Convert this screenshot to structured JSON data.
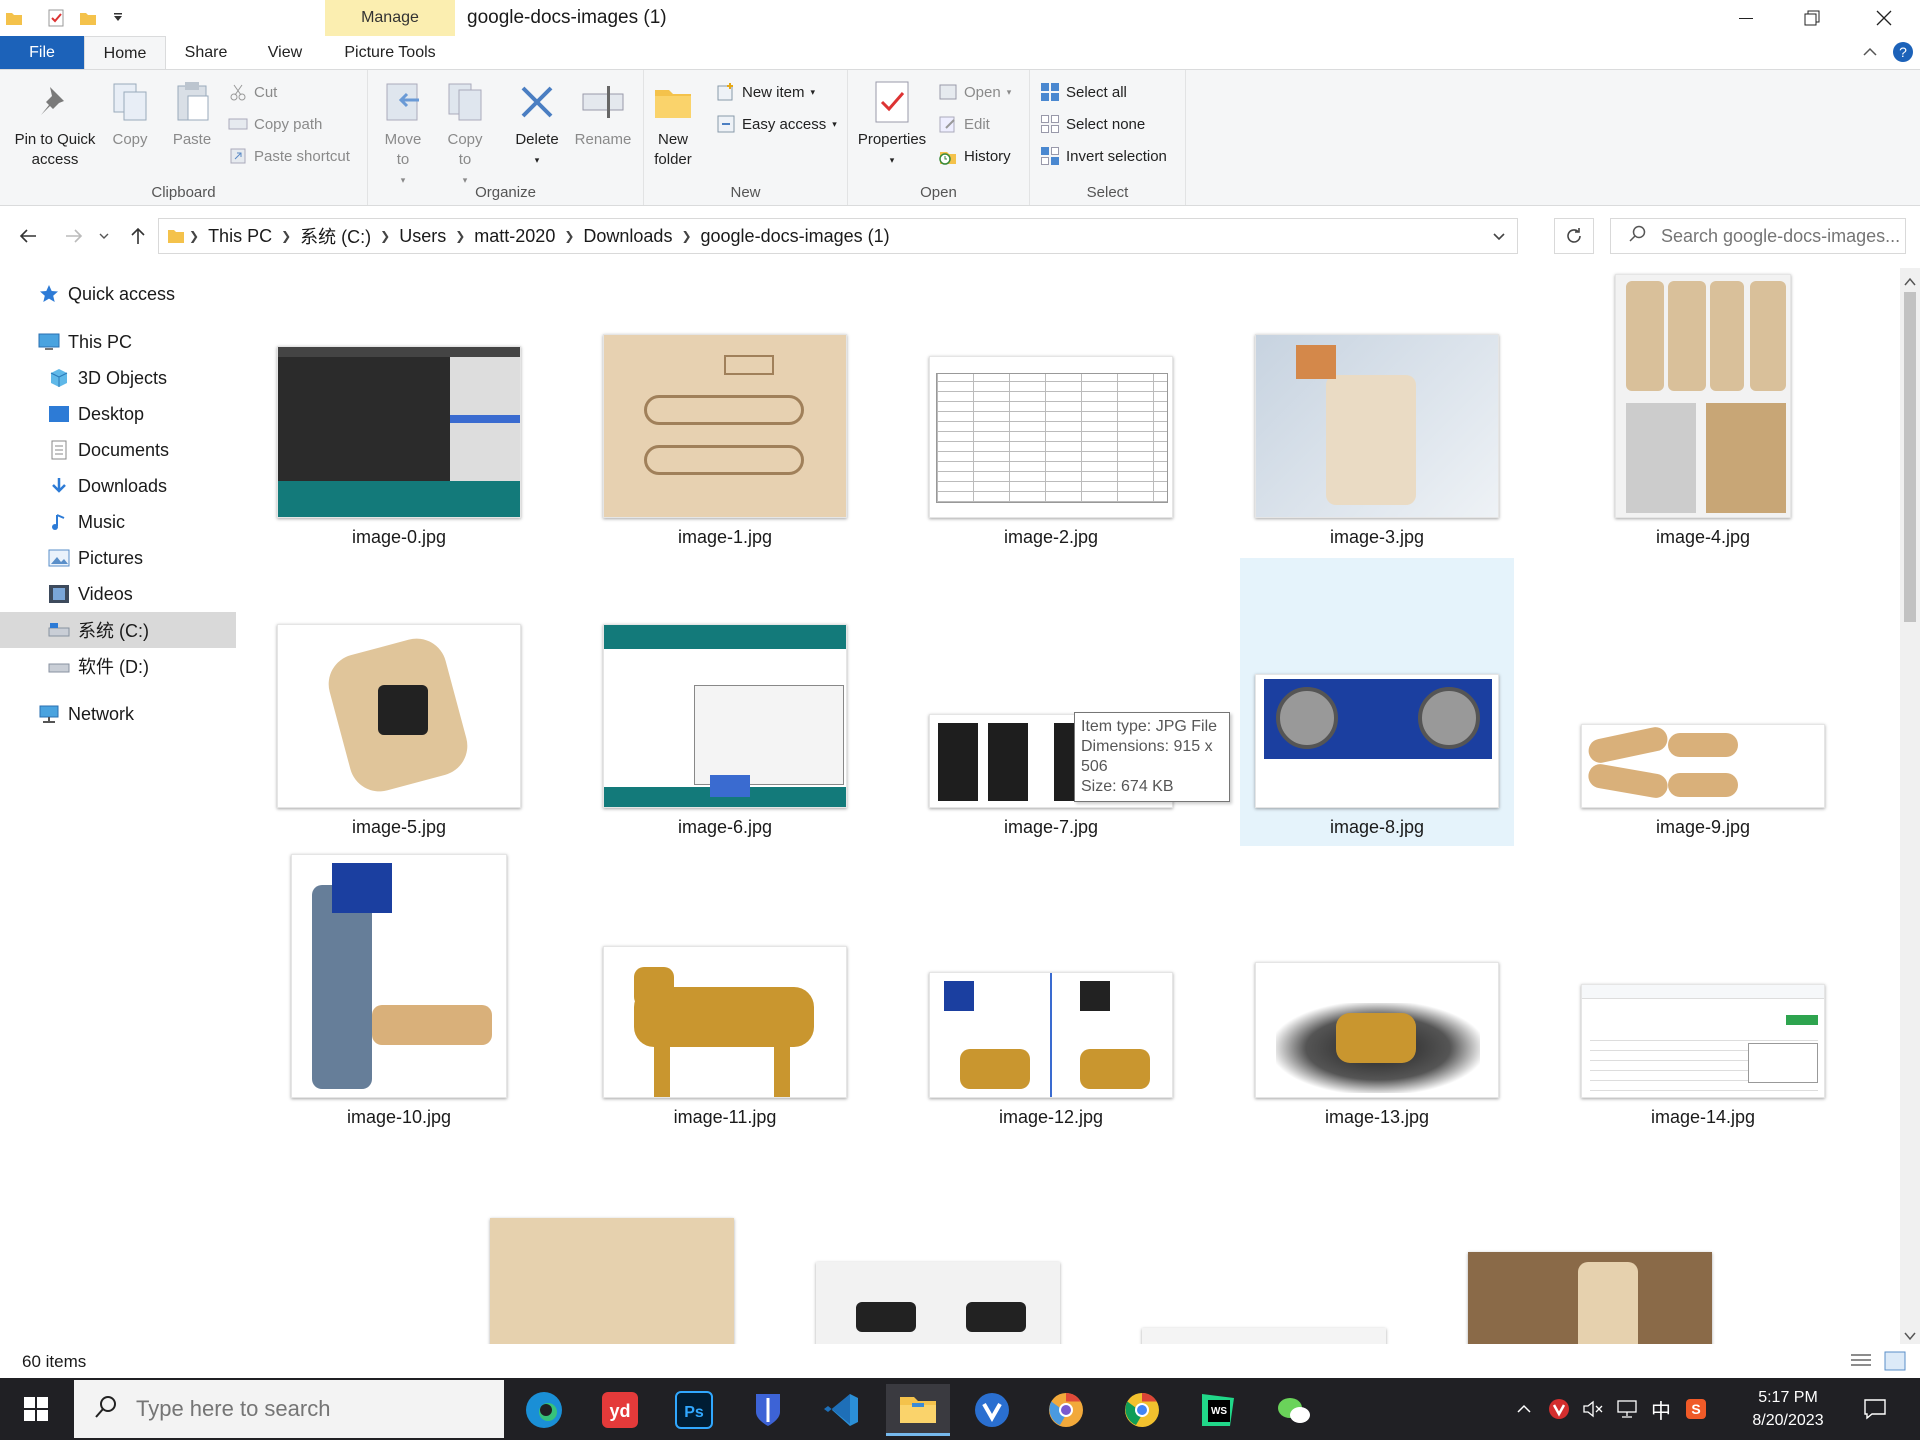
{
  "window": {
    "title": "google-docs-images (1)",
    "context_tab": "Manage"
  },
  "ribbon_tabs": [
    "File",
    "Home",
    "Share",
    "View",
    "Picture Tools"
  ],
  "ribbon": {
    "clipboard": {
      "label": "Clipboard",
      "pin": "Pin to Quick access",
      "copy": "Copy",
      "paste": "Paste",
      "cut": "Cut",
      "copy_path": "Copy path",
      "paste_shortcut": "Paste shortcut"
    },
    "organize": {
      "label": "Organize",
      "move_to": "Move to",
      "copy_to": "Copy to",
      "delete": "Delete",
      "rename": "Rename"
    },
    "new": {
      "label": "New",
      "new_folder": "New folder",
      "new_item": "New item",
      "easy_access": "Easy access"
    },
    "open": {
      "label": "Open",
      "properties": "Properties",
      "open": "Open",
      "edit": "Edit",
      "history": "History"
    },
    "select": {
      "label": "Select",
      "select_all": "Select all",
      "select_none": "Select none",
      "invert": "Invert selection"
    }
  },
  "address": {
    "crumbs": [
      "This PC",
      "系统 (C:)",
      "Users",
      "matt-2020",
      "Downloads",
      "google-docs-images (1)"
    ],
    "search_placeholder": "Search google-docs-images..."
  },
  "nav_pane": {
    "quick_access": "Quick access",
    "this_pc": "This PC",
    "objects_3d": "3D Objects",
    "desktop": "Desktop",
    "documents": "Documents",
    "downloads": "Downloads",
    "music": "Music",
    "pictures": "Pictures",
    "videos": "Videos",
    "drive_c": "系统 (C:)",
    "drive_d": "软件 (D:)",
    "network": "Network"
  },
  "files": [
    {
      "name": "image-0.jpg"
    },
    {
      "name": "image-1.jpg"
    },
    {
      "name": "image-2.jpg"
    },
    {
      "name": "image-3.jpg"
    },
    {
      "name": "image-4.jpg"
    },
    {
      "name": "image-5.jpg"
    },
    {
      "name": "image-6.jpg"
    },
    {
      "name": "image-7.jpg"
    },
    {
      "name": "image-8.jpg"
    },
    {
      "name": "image-9.jpg"
    },
    {
      "name": "image-10.jpg"
    },
    {
      "name": "image-11.jpg"
    },
    {
      "name": "image-12.jpg"
    },
    {
      "name": "image-13.jpg"
    },
    {
      "name": "image-14.jpg"
    }
  ],
  "tooltip": {
    "type": "Item type: JPG File",
    "dimensions": "Dimensions: 915 x 506",
    "size": "Size: 674 KB"
  },
  "status": {
    "count": "60 items"
  },
  "taskbar": {
    "search_placeholder": "Type here to search",
    "time": "5:17 PM",
    "date": "8/20/2023",
    "ime": "中"
  },
  "colors": {
    "accent": "#1c62b9",
    "hover": "#e5f3fb",
    "selected_nav": "#d9d9d9",
    "manage_tab": "#fbeeb0",
    "taskbar": "#202024"
  }
}
